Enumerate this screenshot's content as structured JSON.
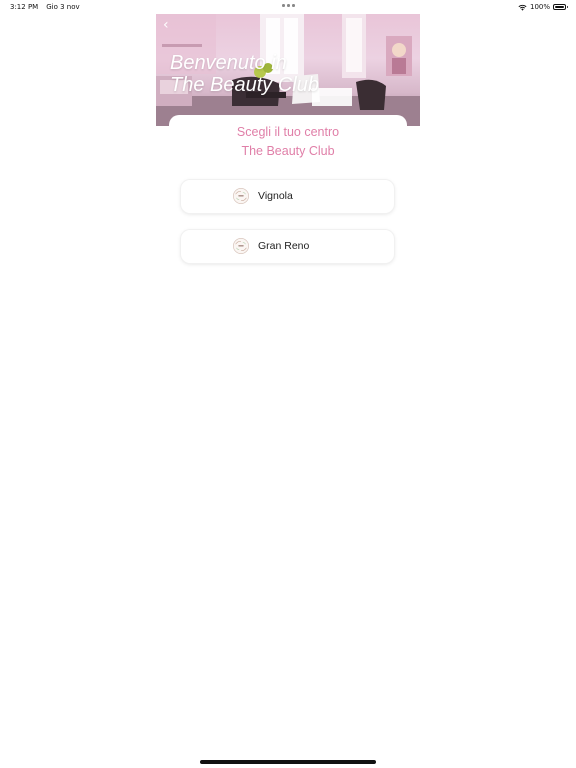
{
  "status_bar": {
    "time": "3:12 PM",
    "date": "Gio 3 nov",
    "battery": "100%",
    "battery_level": 1.0
  },
  "hero": {
    "back_glyph": "‹",
    "title_line1": "Benvenuto in",
    "title_line2": "The Beauty Club",
    "text_color": "#ffffff"
  },
  "subtitle": {
    "line1": "Scegli il tuo centro",
    "line2": "The Beauty Club",
    "color": "#e07fa8"
  },
  "centers": [
    {
      "label": "Vignola",
      "icon": "beauty-club-logo-icon"
    },
    {
      "label": "Gran Reno",
      "icon": "beauty-club-logo-icon"
    }
  ]
}
